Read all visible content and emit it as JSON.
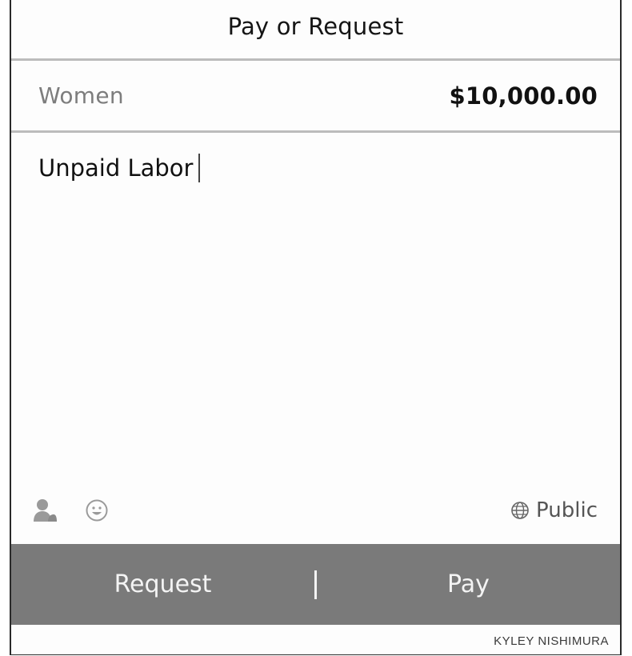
{
  "header": {
    "title": "Pay or Request"
  },
  "payment": {
    "recipient": "Women",
    "amount": "$10,000.00"
  },
  "note": {
    "text": "Unpaid Labor"
  },
  "options": {
    "left_icons": [
      "user-icon",
      "emoji-icon"
    ],
    "privacy_icon": "globe-icon",
    "privacy_label": "Public"
  },
  "actions": {
    "request_label": "Request",
    "pay_label": "Pay"
  },
  "credit": "KYLEY NISHIMURA",
  "colors": {
    "action_bar": "#7a7a7a",
    "divider": "#bcbcbc",
    "muted_text": "#7d7d7d"
  }
}
